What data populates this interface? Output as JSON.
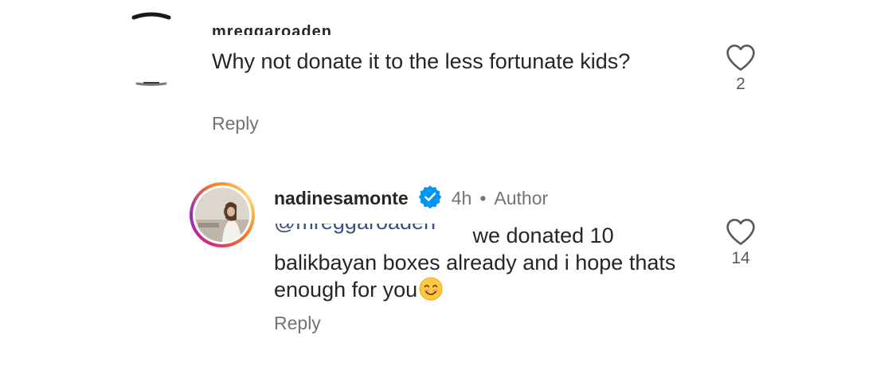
{
  "comments": [
    {
      "username": "mreggaroaden",
      "text": "Why not donate it to the less fortunate kids?",
      "reply_label": "Reply",
      "like_count": "2",
      "icons": {
        "avatar": "avatar-image",
        "like": "heart-outline-icon"
      }
    },
    {
      "username": "nadinesamonte",
      "verified": true,
      "timestamp": "4h",
      "separator": "•",
      "author_badge": "Author",
      "mention": "@mreggaroaden",
      "text": " we donated 10 balikbayan boxes already and i hope thats enough for you",
      "emoji": "smiling-face-emoji",
      "reply_label": "Reply",
      "like_count": "14",
      "icons": {
        "avatar": "avatar-image",
        "verified": "verified-badge-icon",
        "like": "heart-outline-icon"
      }
    }
  ],
  "colors": {
    "text": "#262626",
    "secondary": "#737373",
    "mention": "#385185",
    "verified": "#0095f6",
    "story_ring": [
      "#d62976",
      "#962fbf",
      "#fa7e1e",
      "#feda75"
    ]
  }
}
